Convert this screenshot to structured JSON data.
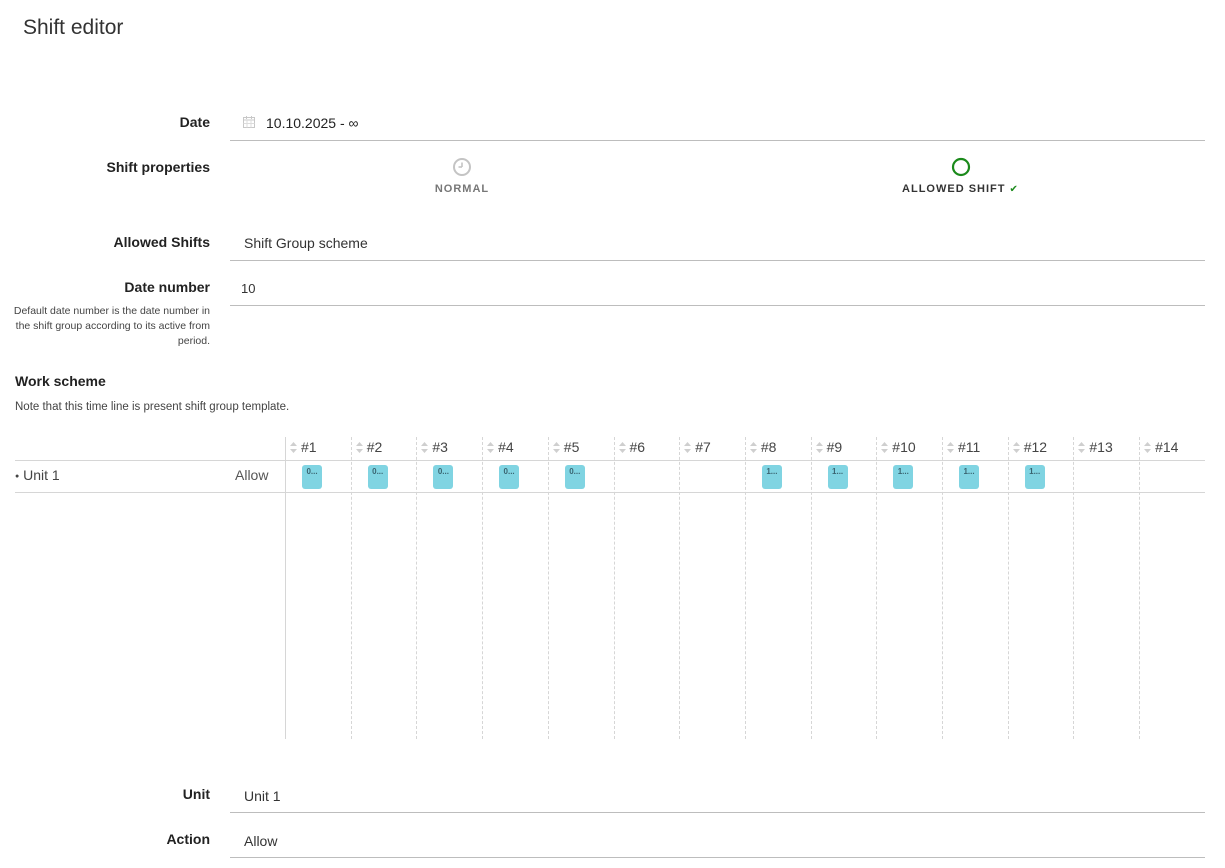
{
  "page": {
    "title": "Shift editor"
  },
  "date": {
    "label": "Date",
    "value": "10.10.2025 - ∞"
  },
  "shift_properties": {
    "label": "Shift properties",
    "options": [
      {
        "label": "NORMAL",
        "selected": false,
        "icon": "clock-icon"
      },
      {
        "label": "ALLOWED SHIFT",
        "selected": true,
        "icon": "circle-icon",
        "check": "✔"
      }
    ],
    "accent_color": "#1b8a1b"
  },
  "allowed_shifts": {
    "label": "Allowed Shifts",
    "value": "Shift Group scheme"
  },
  "date_number": {
    "label": "Date number",
    "value": "10",
    "hint": "Default date number is the date number in the shift group according to its active from period."
  },
  "work_scheme": {
    "title": "Work scheme",
    "note": "Note that this time line is present shift group template.",
    "columns": [
      "#1",
      "#2",
      "#3",
      "#4",
      "#5",
      "#6",
      "#7",
      "#8",
      "#9",
      "#10",
      "#11",
      "#12",
      "#13",
      "#14"
    ],
    "rows": [
      {
        "unit": "Unit 1",
        "action": "Allow",
        "shifts": [
          {
            "col": 1,
            "label": "0..."
          },
          {
            "col": 2,
            "label": "0..."
          },
          {
            "col": 3,
            "label": "0..."
          },
          {
            "col": 4,
            "label": "0..."
          },
          {
            "col": 5,
            "label": "0..."
          },
          {
            "col": 8,
            "label": "1..."
          },
          {
            "col": 9,
            "label": "1..."
          },
          {
            "col": 10,
            "label": "1..."
          },
          {
            "col": 11,
            "label": "1..."
          },
          {
            "col": 12,
            "label": "1..."
          }
        ]
      }
    ],
    "block_color": "#80d4e2"
  },
  "unit": {
    "label": "Unit",
    "value": "Unit 1"
  },
  "action": {
    "label": "Action",
    "value": "Allow"
  }
}
